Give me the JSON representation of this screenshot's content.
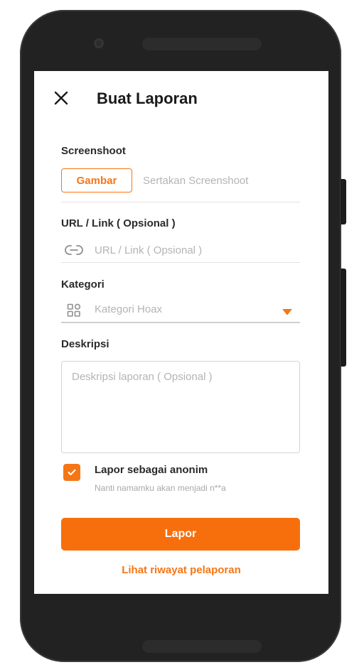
{
  "header": {
    "title": "Buat Laporan",
    "close_icon": "close-icon"
  },
  "screenshot": {
    "label": "Screenshoot",
    "button_label": "Gambar",
    "hint": "Sertakan Screenshoot"
  },
  "url": {
    "label": "URL / Link ( Opsional )",
    "placeholder": "URL / Link ( Opsional )",
    "icon": "link-icon"
  },
  "category": {
    "label": "Kategori",
    "placeholder": "Kategori Hoax",
    "icon": "grid-icon",
    "dropdown_icon": "caret-down-icon"
  },
  "description": {
    "label": "Deskripsi",
    "placeholder": "Deskripsi laporan ( Opsional )"
  },
  "anonymous": {
    "checked": true,
    "label": "Lapor sebagai anonim",
    "subtext": "Nanti namamku akan menjadi n**a"
  },
  "actions": {
    "submit_label": "Lapor",
    "history_link": "Lihat riwayat pelaporan"
  },
  "colors": {
    "accent": "#F57615",
    "button": "#F76F0C",
    "device": "#222222"
  }
}
